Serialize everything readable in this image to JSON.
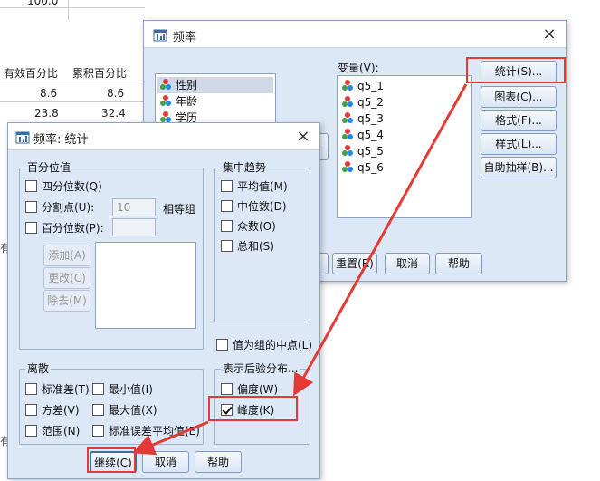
{
  "background_table": {
    "top_value": "100.0",
    "headers": [
      "有效百分比",
      "累积百分比"
    ],
    "rows": [
      [
        "8.6",
        "8.6"
      ],
      [
        "23.8",
        "32.4"
      ]
    ],
    "left_fragments": [
      "有",
      "有"
    ]
  },
  "freq_dialog": {
    "title": "频率",
    "close_label": "×",
    "source_vars": [
      "性别",
      "年龄",
      "学历"
    ],
    "vars_label": "变量(V):",
    "target_vars": [
      "q5_1",
      "q5_2",
      "q5_3",
      "q5_4",
      "q5_5",
      "q5_6"
    ],
    "side_buttons": [
      "统计(S)...",
      "图表(C)...",
      "格式(F)...",
      "样式(L)...",
      "自助抽样(B)..."
    ],
    "bottom_buttons": [
      "重置(R)",
      "取消",
      "帮助"
    ]
  },
  "stats_dialog": {
    "title": "频率: 统计",
    "close_label": "×",
    "percentile": {
      "group_label": "百分位值",
      "quartiles": "四分位数(Q)",
      "cutpoints": "分割点(U):",
      "cutpoints_value": "10",
      "equal_groups": "相等组",
      "percentiles": "百分位数(P):",
      "add": "添加(A)",
      "change": "更改(C)",
      "remove": "除去(M)"
    },
    "central": {
      "group_label": "集中趋势",
      "items": [
        "平均值(M)",
        "中位数(D)",
        "众数(O)",
        "总和(S)"
      ]
    },
    "midpoints": "值为组的中点(L)",
    "dispersion": {
      "group_label": "离散",
      "items": [
        "标准差(T)",
        "最小值(I)",
        "方差(V)",
        "最大值(X)",
        "范围(N)",
        "标准误差平均值(E)"
      ]
    },
    "distribution": {
      "group_label": "表示后验分布...",
      "skewness": "偏度(W)",
      "kurtosis": "峰度(K)",
      "kurtosis_checked": true
    },
    "buttons": [
      "继续(C)",
      "取消",
      "帮助"
    ]
  },
  "colors": {
    "highlight": "#e53935",
    "dialog_bg": "#dde8f6"
  }
}
